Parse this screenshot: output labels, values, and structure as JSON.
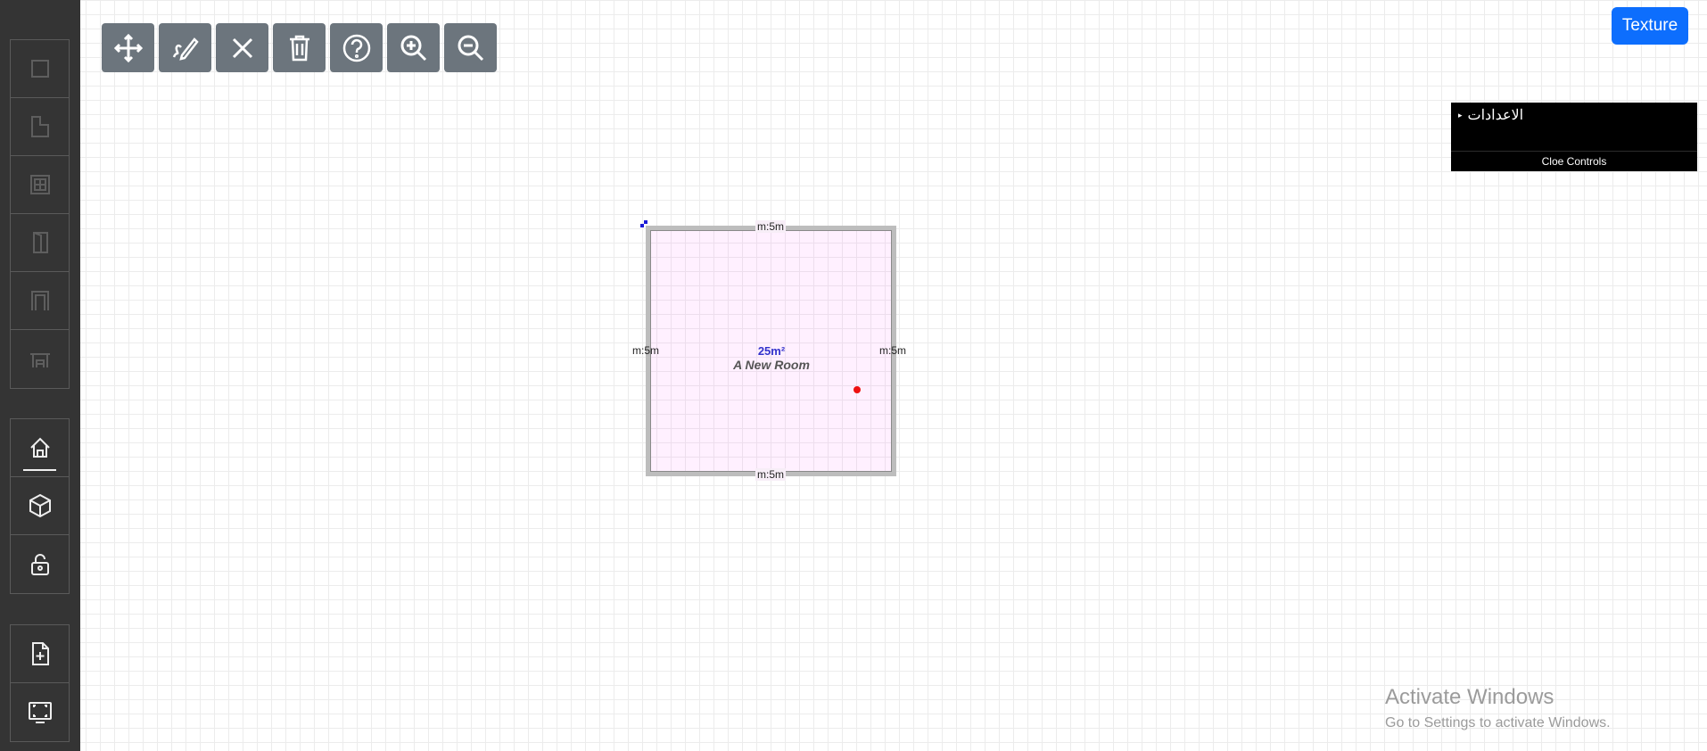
{
  "sidebar": {
    "draw_tools": [
      {
        "name": "wall-tool",
        "icon": "square-icon",
        "enabled": false
      },
      {
        "name": "room-tool",
        "icon": "corner-shape-icon",
        "enabled": false
      },
      {
        "name": "window-tool",
        "icon": "window-icon",
        "enabled": false
      },
      {
        "name": "door-tool",
        "icon": "door-icon",
        "enabled": false
      },
      {
        "name": "arch-tool",
        "icon": "arch-icon",
        "enabled": false
      },
      {
        "name": "stairs-tool",
        "icon": "stairs-icon",
        "enabled": false
      }
    ],
    "view_tools": [
      {
        "name": "2d-home-view",
        "icon": "home-icon",
        "selected": true
      },
      {
        "name": "3d-view",
        "icon": "cube-icon"
      },
      {
        "name": "lock-toggle",
        "icon": "unlock-icon"
      }
    ],
    "file_tools": [
      {
        "name": "new-file",
        "icon": "file-plus-icon"
      },
      {
        "name": "fullscreen",
        "icon": "fullscreen-icon"
      }
    ]
  },
  "toolbar": {
    "buttons": [
      {
        "name": "move-button",
        "icon": "move-arrows-icon"
      },
      {
        "name": "draw-button",
        "icon": "pen-icon"
      },
      {
        "name": "cancel-button",
        "icon": "x-icon"
      },
      {
        "name": "delete-button",
        "icon": "trash-icon"
      },
      {
        "name": "help-button",
        "icon": "question-icon"
      },
      {
        "name": "zoom-in-button",
        "icon": "zoom-in-icon"
      },
      {
        "name": "zoom-out-button",
        "icon": "zoom-out-icon"
      }
    ]
  },
  "texture_button": {
    "label": "Texture",
    "color": "#0d6efd"
  },
  "settings": {
    "title": "الاعدادات",
    "close_label": "Cloe Controls"
  },
  "room": {
    "name": "A New Room",
    "area": "25m²",
    "dims": {
      "top": "m:5m",
      "bottom": "m:5m",
      "left": "m:5m",
      "right": "m:5m"
    },
    "fill_color": "#fdf0fd",
    "wall_color": "#bdbdbd"
  },
  "watermark": {
    "title": "Activate Windows",
    "subtitle": "Go to Settings to activate Windows."
  }
}
